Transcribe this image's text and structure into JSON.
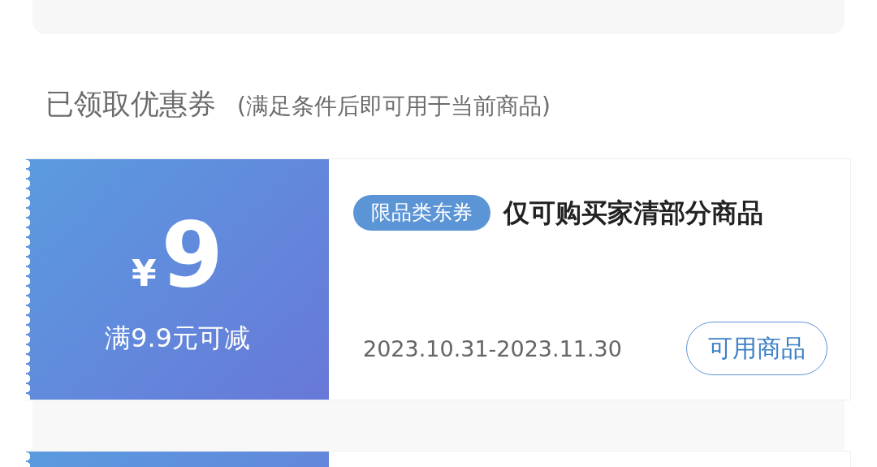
{
  "section": {
    "title": "已领取优惠券",
    "note": "(满足条件后即可用于当前商品)"
  },
  "coupons": [
    {
      "currency": "¥",
      "amount": "9",
      "condition": "满9.9元可减",
      "tag": "限品类东券",
      "title": "仅可购买家清部分商品",
      "validity": "2023.10.31-2023.11.30",
      "action": "可用商品"
    }
  ]
}
